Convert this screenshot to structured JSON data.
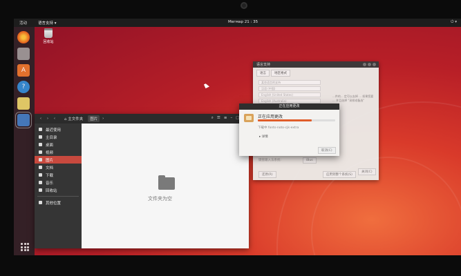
{
  "topbar": {
    "activities": "活动",
    "app_menu": "语言支持 ▾",
    "clock": "Meгмар 21 : 35",
    "system": "⏻ ▾"
  },
  "dock": {
    "items": [
      "firefox-icon",
      "files-icon",
      "software-center-icon",
      "help-icon",
      "notes-icon",
      "language-support-icon"
    ]
  },
  "desktop": {
    "trash_label": "回收站"
  },
  "file_manager": {
    "header": {
      "home": "主文件夹",
      "current": "图片"
    },
    "sidebar": [
      "最近使用",
      "主目录",
      "桌面",
      "视频",
      "图片",
      "文档",
      "下载",
      "音乐",
      "回收站",
      "其他位置"
    ],
    "selected_index": 4,
    "empty_text": "文件夹为空"
  },
  "software_dialog": {
    "title": "语言支持",
    "tabs": [
      "语言",
      "地区格式"
    ],
    "rows": [
      "某些语言的支持",
      "汉语 (中国)",
      "English (United States)",
      "English (Australia)"
    ],
    "paragraph": "...件的... 定可以去掉 ... 如果您要 ... 并且选择 \"采样成备选\"",
    "close_label": "关闭(C)",
    "auth_label": "键盘输入法系统:",
    "auth_value": "iBus",
    "revert_label": "还原(R)",
    "system_label": "应用到整个系统(S)"
  },
  "apply_dialog": {
    "title": "正在应用更改",
    "heading": "正在应用更改",
    "progress": 0.7,
    "download_text": "下载中 fonts-noto-cjk-extra",
    "details_label": "详情",
    "cancel_label": "取消(C)"
  },
  "colors": {
    "accent": "#e05d2a",
    "selected": "#c8493e"
  }
}
